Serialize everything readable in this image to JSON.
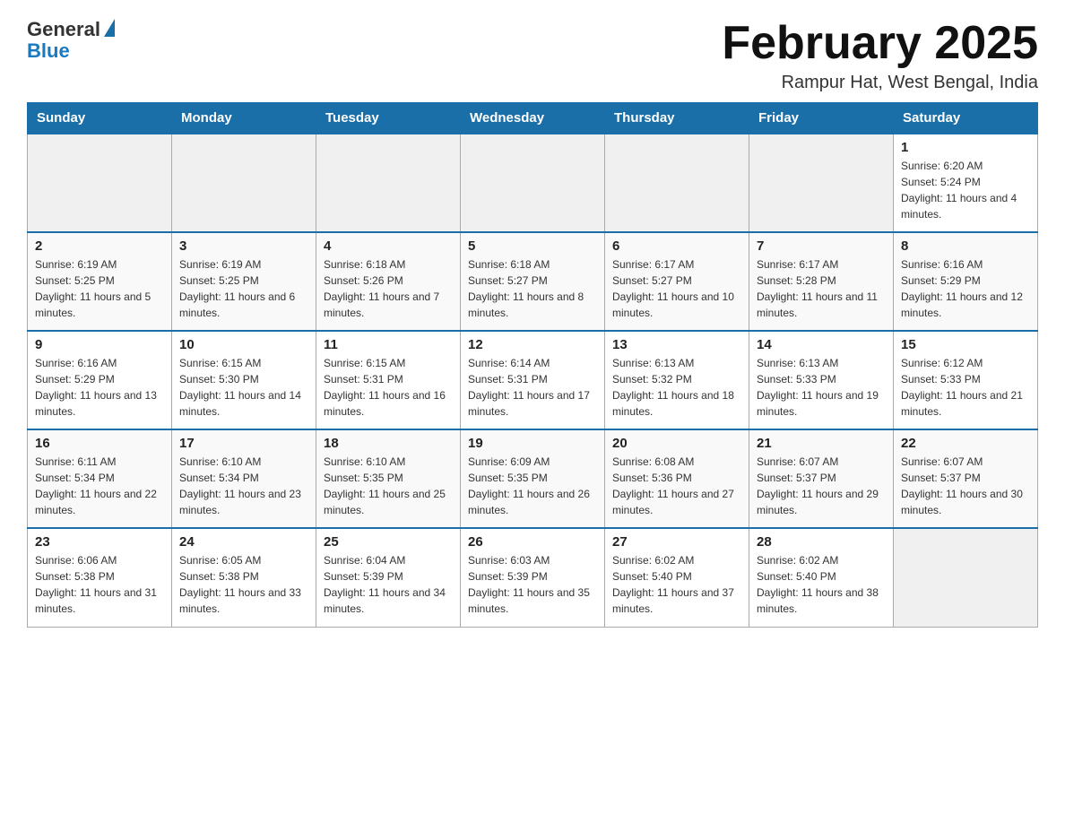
{
  "header": {
    "logo_general": "General",
    "logo_blue": "Blue",
    "month_title": "February 2025",
    "location": "Rampur Hat, West Bengal, India"
  },
  "days_of_week": [
    "Sunday",
    "Monday",
    "Tuesday",
    "Wednesday",
    "Thursday",
    "Friday",
    "Saturday"
  ],
  "weeks": [
    {
      "days": [
        {
          "num": "",
          "empty": true
        },
        {
          "num": "",
          "empty": true
        },
        {
          "num": "",
          "empty": true
        },
        {
          "num": "",
          "empty": true
        },
        {
          "num": "",
          "empty": true
        },
        {
          "num": "",
          "empty": true
        },
        {
          "num": "1",
          "sunrise": "6:20 AM",
          "sunset": "5:24 PM",
          "daylight": "11 hours and 4 minutes."
        }
      ]
    },
    {
      "days": [
        {
          "num": "2",
          "sunrise": "6:19 AM",
          "sunset": "5:25 PM",
          "daylight": "11 hours and 5 minutes."
        },
        {
          "num": "3",
          "sunrise": "6:19 AM",
          "sunset": "5:25 PM",
          "daylight": "11 hours and 6 minutes."
        },
        {
          "num": "4",
          "sunrise": "6:18 AM",
          "sunset": "5:26 PM",
          "daylight": "11 hours and 7 minutes."
        },
        {
          "num": "5",
          "sunrise": "6:18 AM",
          "sunset": "5:27 PM",
          "daylight": "11 hours and 8 minutes."
        },
        {
          "num": "6",
          "sunrise": "6:17 AM",
          "sunset": "5:27 PM",
          "daylight": "11 hours and 10 minutes."
        },
        {
          "num": "7",
          "sunrise": "6:17 AM",
          "sunset": "5:28 PM",
          "daylight": "11 hours and 11 minutes."
        },
        {
          "num": "8",
          "sunrise": "6:16 AM",
          "sunset": "5:29 PM",
          "daylight": "11 hours and 12 minutes."
        }
      ]
    },
    {
      "days": [
        {
          "num": "9",
          "sunrise": "6:16 AM",
          "sunset": "5:29 PM",
          "daylight": "11 hours and 13 minutes."
        },
        {
          "num": "10",
          "sunrise": "6:15 AM",
          "sunset": "5:30 PM",
          "daylight": "11 hours and 14 minutes."
        },
        {
          "num": "11",
          "sunrise": "6:15 AM",
          "sunset": "5:31 PM",
          "daylight": "11 hours and 16 minutes."
        },
        {
          "num": "12",
          "sunrise": "6:14 AM",
          "sunset": "5:31 PM",
          "daylight": "11 hours and 17 minutes."
        },
        {
          "num": "13",
          "sunrise": "6:13 AM",
          "sunset": "5:32 PM",
          "daylight": "11 hours and 18 minutes."
        },
        {
          "num": "14",
          "sunrise": "6:13 AM",
          "sunset": "5:33 PM",
          "daylight": "11 hours and 19 minutes."
        },
        {
          "num": "15",
          "sunrise": "6:12 AM",
          "sunset": "5:33 PM",
          "daylight": "11 hours and 21 minutes."
        }
      ]
    },
    {
      "days": [
        {
          "num": "16",
          "sunrise": "6:11 AM",
          "sunset": "5:34 PM",
          "daylight": "11 hours and 22 minutes."
        },
        {
          "num": "17",
          "sunrise": "6:10 AM",
          "sunset": "5:34 PM",
          "daylight": "11 hours and 23 minutes."
        },
        {
          "num": "18",
          "sunrise": "6:10 AM",
          "sunset": "5:35 PM",
          "daylight": "11 hours and 25 minutes."
        },
        {
          "num": "19",
          "sunrise": "6:09 AM",
          "sunset": "5:35 PM",
          "daylight": "11 hours and 26 minutes."
        },
        {
          "num": "20",
          "sunrise": "6:08 AM",
          "sunset": "5:36 PM",
          "daylight": "11 hours and 27 minutes."
        },
        {
          "num": "21",
          "sunrise": "6:07 AM",
          "sunset": "5:37 PM",
          "daylight": "11 hours and 29 minutes."
        },
        {
          "num": "22",
          "sunrise": "6:07 AM",
          "sunset": "5:37 PM",
          "daylight": "11 hours and 30 minutes."
        }
      ]
    },
    {
      "days": [
        {
          "num": "23",
          "sunrise": "6:06 AM",
          "sunset": "5:38 PM",
          "daylight": "11 hours and 31 minutes."
        },
        {
          "num": "24",
          "sunrise": "6:05 AM",
          "sunset": "5:38 PM",
          "daylight": "11 hours and 33 minutes."
        },
        {
          "num": "25",
          "sunrise": "6:04 AM",
          "sunset": "5:39 PM",
          "daylight": "11 hours and 34 minutes."
        },
        {
          "num": "26",
          "sunrise": "6:03 AM",
          "sunset": "5:39 PM",
          "daylight": "11 hours and 35 minutes."
        },
        {
          "num": "27",
          "sunrise": "6:02 AM",
          "sunset": "5:40 PM",
          "daylight": "11 hours and 37 minutes."
        },
        {
          "num": "28",
          "sunrise": "6:02 AM",
          "sunset": "5:40 PM",
          "daylight": "11 hours and 38 minutes."
        },
        {
          "num": "",
          "empty": true
        }
      ]
    }
  ]
}
